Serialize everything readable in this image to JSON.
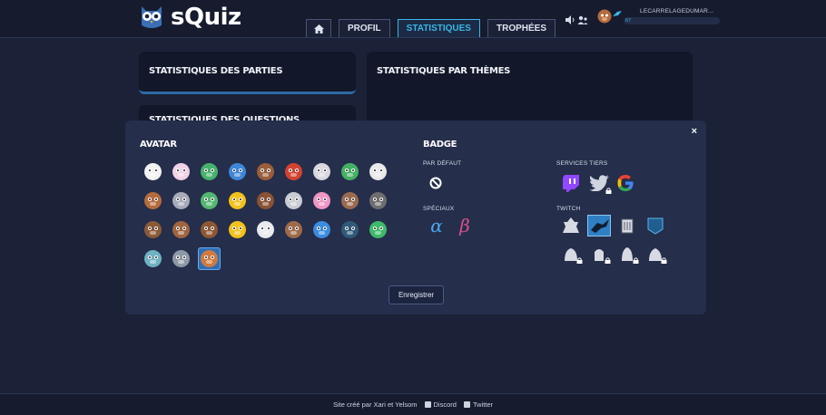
{
  "app": {
    "name": "sQuiz"
  },
  "nav": {
    "home_icon": "home-icon",
    "items": [
      {
        "label": "PROFIL",
        "active": false
      },
      {
        "label": "STATISTIQUES",
        "active": true
      },
      {
        "label": "TROPHÉES",
        "active": false
      }
    ]
  },
  "user": {
    "name": "LECARRELAGEDUMAR...",
    "level": "67",
    "icons": [
      "volume-icon",
      "users-icon"
    ]
  },
  "panels": {
    "stats_games": "STATISTIQUES DES PARTIES",
    "stats_themes": "STATISTIQUES PAR THÈMES",
    "stats_questions": "STATISTIQUES DES QUESTIONS"
  },
  "modal": {
    "close_label": "×",
    "avatar_title": "AVATAR",
    "badge_title": "BADGE",
    "default_label": "PAR DÉFAUT",
    "special_label": "SPÉCIAUX",
    "services_label": "SERVICES TIERS",
    "twitch_label": "TWITCH",
    "alpha": "α",
    "beta": "β",
    "save_label": "Enregistrer",
    "selected_avatar": 29,
    "avatars": [
      "chicken",
      "cow",
      "frog",
      "blue-bird",
      "bear",
      "parrot",
      "rabbit",
      "duck",
      "panda",
      "monkey",
      "elephant",
      "frog",
      "chick",
      "bear",
      "sheep",
      "pig",
      "owl",
      "gorilla",
      "moose",
      "bear",
      "horse",
      "chick",
      "seal",
      "sloth",
      "narwhal",
      "penguin",
      "snake",
      "hippo",
      "walrus",
      "owl"
    ],
    "avatar_colors": [
      "#f2f2f2",
      "#f1d2e6",
      "#47b26c",
      "#3f86d8",
      "#9b5e3a",
      "#d2432f",
      "#d8d8de",
      "#45b064",
      "#e9e9e9",
      "#b56b3c",
      "#a7abb9",
      "#54b771",
      "#f2c21b",
      "#8a5334",
      "#c9ccd3",
      "#f095c4",
      "#9a6a4f",
      "#6e6e6e",
      "#8b5a36",
      "#a0653f",
      "#8e5734",
      "#f2c21b",
      "#e9eaee",
      "#a06a48",
      "#3b8de0",
      "#2f5a79",
      "#3fb96a",
      "#6fb2c2",
      "#8f98a6",
      "#d07a3f"
    ],
    "service_icons": [
      "twitch-icon",
      "twitter-icon",
      "google-icon"
    ],
    "twitch_badges": [
      "twitch-badge-1",
      "twitch-badge-2",
      "twitch-badge-3",
      "twitch-badge-4",
      "twitch-badge-5",
      "twitch-badge-6",
      "twitch-badge-7",
      "twitch-badge-8"
    ]
  },
  "footer": {
    "credit": "Site créé par Xari et Yelsom",
    "discord": "Discord",
    "twitter": "Twitter"
  },
  "colors": {
    "accent": "#3ab7e6",
    "background": "#1b2137",
    "modal": "#252e4b"
  }
}
